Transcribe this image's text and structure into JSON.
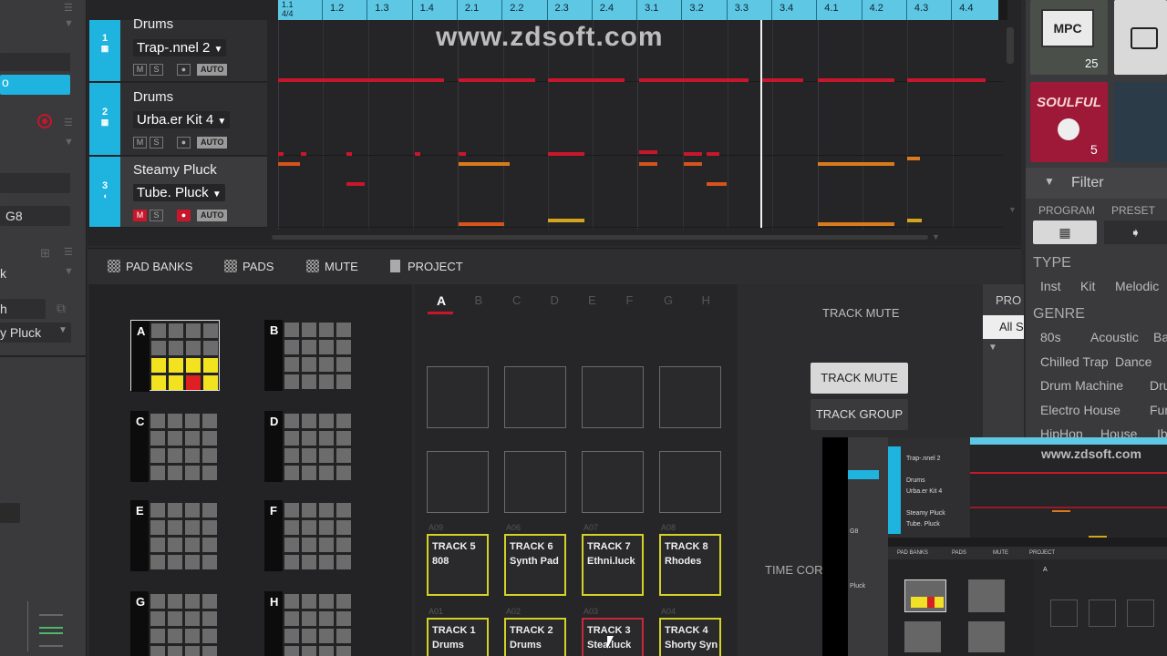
{
  "watermark": "www.zdsoft.com",
  "left_strip": {
    "field_g8": "G8",
    "pluck": "y Pluck",
    "h": "h",
    "k": "k"
  },
  "ruler": {
    "origin": "1.1",
    "origin_sub": "4/4",
    "ticks": [
      "1.2",
      "1.3",
      "1.4",
      "2.1",
      "2.2",
      "2.3",
      "2.4",
      "3.1",
      "3.2",
      "3.3",
      "3.4",
      "4.1",
      "4.2",
      "4.3",
      "4.4"
    ]
  },
  "tracks": [
    {
      "num": "1",
      "name": "Drums",
      "instrument": "Trap-.nnel 2",
      "mute": "M",
      "solo": "S",
      "auto": "AUTO"
    },
    {
      "num": "2",
      "name": "Drums",
      "instrument": "Urba.er Kit 4",
      "mute": "M",
      "solo": "S",
      "auto": "AUTO"
    },
    {
      "num": "3",
      "name": "Steamy Pluck",
      "instrument": "Tube. Pluck",
      "mute": "M",
      "solo": "S",
      "auto": "AUTO"
    }
  ],
  "tabs": [
    {
      "label": "PAD BANKS"
    },
    {
      "label": "PADS"
    },
    {
      "label": "MUTE"
    },
    {
      "label": "PROJECT"
    }
  ],
  "pad_banks": [
    "A",
    "B",
    "C",
    "D",
    "E",
    "F",
    "G",
    "H"
  ],
  "bank_letters": [
    "A",
    "B",
    "C",
    "D",
    "E",
    "F",
    "G",
    "H"
  ],
  "pads": {
    "row3_small": [
      "A09",
      "A06",
      "A07",
      "A08"
    ],
    "row3": [
      {
        "l1": "TRACK 5",
        "l2": "808"
      },
      {
        "l1": "TRACK 6",
        "l2": "Synth Pad"
      },
      {
        "l1": "TRACK 7",
        "l2": "Ethni.luck"
      },
      {
        "l1": "TRACK 8",
        "l2": "Rhodes"
      }
    ],
    "row4_small": [
      "A01",
      "A02",
      "A03",
      "A04"
    ],
    "row4": [
      {
        "l1": "TRACK 1",
        "l2": "Drums"
      },
      {
        "l1": "TRACK 2",
        "l2": "Drums"
      },
      {
        "l1": "TRACK 3",
        "l2": "Stea.luck"
      },
      {
        "l1": "TRACK 4",
        "l2": "Shorty Syn"
      }
    ]
  },
  "mute_panel": {
    "title": "TRACK MUTE",
    "btn_mute": "TRACK MUTE",
    "btn_group": "TRACK GROUP",
    "time_corr": "TIME CORR",
    "pro": "PRO",
    "all": "All S"
  },
  "browser": {
    "filter": "Filter",
    "program": "PROGRAM",
    "preset": "PRESET",
    "type_hdr": "TYPE",
    "types": [
      "Inst",
      "Kit",
      "Melodic"
    ],
    "genre_hdr": "GENRE",
    "genres": [
      [
        "80s",
        "Acoustic",
        "Bas"
      ],
      [
        "Chilled Trap",
        "Dance"
      ],
      [
        "Drum Machine",
        "Dru"
      ],
      [
        "Electro House",
        "Funk"
      ],
      [
        "HipHop",
        "House",
        "Ib"
      ]
    ],
    "badge1": "25",
    "badge2": "5",
    "thumb_text": "MPC",
    "thumb_text2": "SOULFUL"
  },
  "pip": {
    "watermark": "www.zdsoft.com",
    "t1": "Trap-.nnel 2",
    "t2_name": "Drums",
    "t2": "Urba.er Kit 4",
    "t3_name": "Steamy Pluck",
    "t3": "Tube. Pluck",
    "tabs": [
      "PAD BANKS",
      "PADS",
      "MUTE",
      "PROJECT"
    ],
    "bank_a": "A"
  }
}
